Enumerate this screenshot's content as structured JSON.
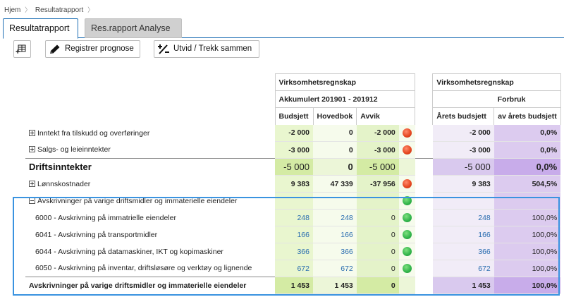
{
  "breadcrumb": {
    "home": "Hjem",
    "current": "Resultatrapport",
    "sep": "〉"
  },
  "tabs": [
    {
      "label": "Resultatrapport",
      "active": true
    },
    {
      "label": "Res.rapport Analyse",
      "active": false
    }
  ],
  "toolbar": {
    "register_label": "Registrer prognose",
    "expand_label": "Utvid / Trekk sammen"
  },
  "headers": {
    "group1_title": "Virksomhetsregnskap",
    "group1_period": "Akkumulert 201901 - 201912",
    "col_budsjett": "Budsjett",
    "col_hovedbok": "Hovedbok",
    "col_avvik": "Avvik",
    "group2_title": "Virksomhetsregnskap",
    "group2_sub": "Forbruk",
    "col_arets_budsjett": "Årets budsjett",
    "col_forbruk": "av årets budsjett"
  },
  "rows": [
    {
      "label": "Inntekt fra tilskudd og overføringer",
      "budsjett": "-2 000",
      "hovedbok": "0",
      "avvik": "-2 000",
      "status": "red",
      "arets_budsjett": "-2 000",
      "forbruk": "0,0%"
    },
    {
      "label": "Salgs- og leieinntekter",
      "budsjett": "-3 000",
      "hovedbok": "0",
      "avvik": "-3 000",
      "status": "red",
      "arets_budsjett": "-3 000",
      "forbruk": "0,0%"
    },
    {
      "label": "Driftsinntekter",
      "budsjett": "-5 000",
      "hovedbok": "0",
      "avvik": "-5 000",
      "status": "none",
      "arets_budsjett": "-5 000",
      "forbruk": "0,0%"
    },
    {
      "label": "Lønnskostnader",
      "budsjett": "9 383",
      "hovedbok": "47 339",
      "avvik": "-37 956",
      "status": "red",
      "arets_budsjett": "9 383",
      "forbruk": "504,5%"
    },
    {
      "label": "Avskrivninger på varige driftsmidler og immaterielle eiendeler",
      "budsjett": "",
      "hovedbok": "",
      "avvik": "",
      "status": "green",
      "arets_budsjett": "",
      "forbruk": ""
    },
    {
      "label": "6000 - Avskrivning på immatrielle eiendeler",
      "budsjett": "248",
      "hovedbok": "248",
      "avvik": "0",
      "status": "green",
      "arets_budsjett": "248",
      "forbruk": "100,0%"
    },
    {
      "label": "6041 - Avskrivning på transportmidler",
      "budsjett": "166",
      "hovedbok": "166",
      "avvik": "0",
      "status": "green",
      "arets_budsjett": "166",
      "forbruk": "100,0%"
    },
    {
      "label": "6044 - Avskrivning på datamaskiner, IKT og kopimaskiner",
      "budsjett": "366",
      "hovedbok": "366",
      "avvik": "0",
      "status": "green",
      "arets_budsjett": "366",
      "forbruk": "100,0%"
    },
    {
      "label": "6050 - Avskrivning på inventar, driftsløsøre og verktøy og lignende",
      "budsjett": "672",
      "hovedbok": "672",
      "avvik": "0",
      "status": "green",
      "arets_budsjett": "672",
      "forbruk": "100,0%"
    },
    {
      "label": "Avskrivninger på varige driftsmidler og immaterielle eiendeler",
      "budsjett": "1 453",
      "hovedbok": "1 453",
      "avvik": "0",
      "status": "none",
      "arets_budsjett": "1 453",
      "forbruk": "100,0%"
    }
  ],
  "colors": {
    "accent": "#1e6fb5",
    "highlight": "#3a93e0",
    "red_status": "#e4441e",
    "green_status": "#30b44a",
    "link_number": "#2a6db0"
  }
}
